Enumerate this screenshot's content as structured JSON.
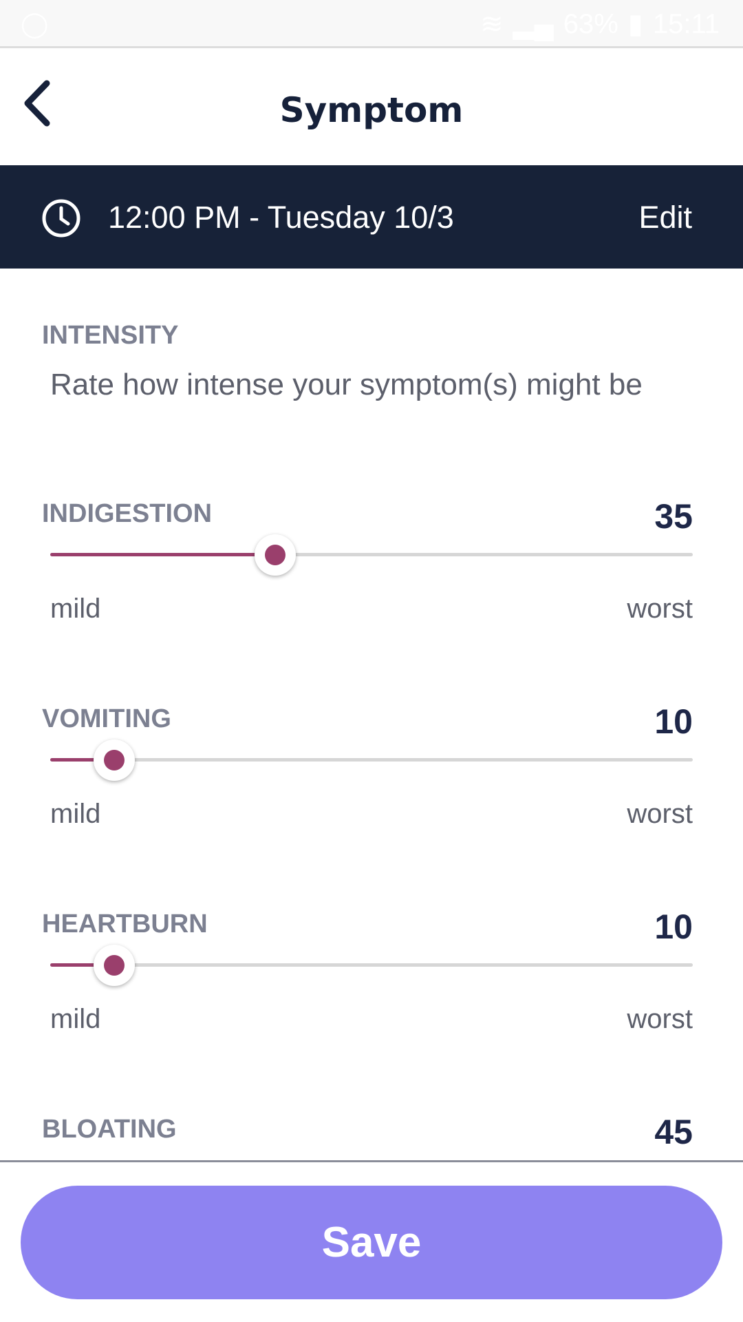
{
  "status_bar": {
    "battery": "63%",
    "time": "15:11"
  },
  "header": {
    "title": "Symptom"
  },
  "datetime_band": {
    "text": "12:00 PM - Tuesday 10/3",
    "edit_label": "Edit"
  },
  "intensity": {
    "label": "INTENSITY",
    "description": "Rate how intense your symptom(s) might be"
  },
  "symptoms": [
    {
      "name": "INDIGESTION",
      "value": "35",
      "min_label": "mild",
      "max_label": "worst"
    },
    {
      "name": "VOMITING",
      "value": "10",
      "min_label": "mild",
      "max_label": "worst"
    },
    {
      "name": "HEARTBURN",
      "value": "10",
      "min_label": "mild",
      "max_label": "worst"
    },
    {
      "name": "BLOATING",
      "value": "45"
    }
  ],
  "slider_range": [
    0,
    100
  ],
  "colors": {
    "accent": "#9a3f6c",
    "band": "#172238",
    "save": "#8e83f1"
  },
  "save_label": "Save"
}
